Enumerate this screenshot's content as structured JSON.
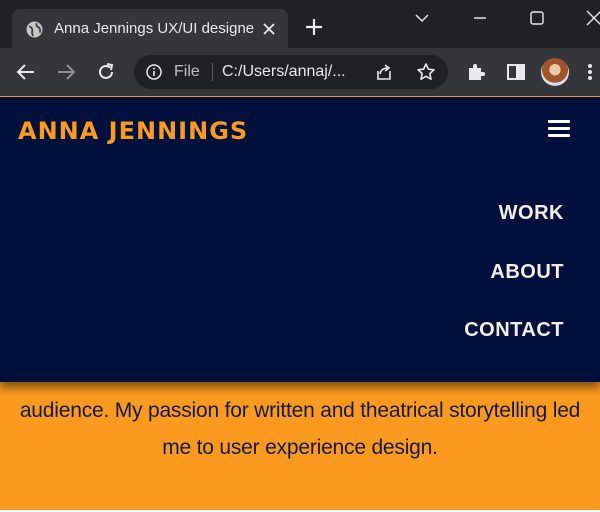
{
  "browser": {
    "tab": {
      "title": "Anna Jennings UX/UI designer"
    },
    "address_bar": {
      "file_label": "File",
      "url": "C:/Users/annaj/..."
    }
  },
  "site": {
    "logo": "ANNA JENNINGS",
    "menu": [
      "WORK",
      "ABOUT",
      "CONTACT"
    ],
    "body_text": "audience. My passion for written and theatrical storytelling led me to user experience design."
  },
  "colors": {
    "accent_orange": "#fb9a1f",
    "nav_navy": "#00103c",
    "chrome_dark": "#202124"
  }
}
